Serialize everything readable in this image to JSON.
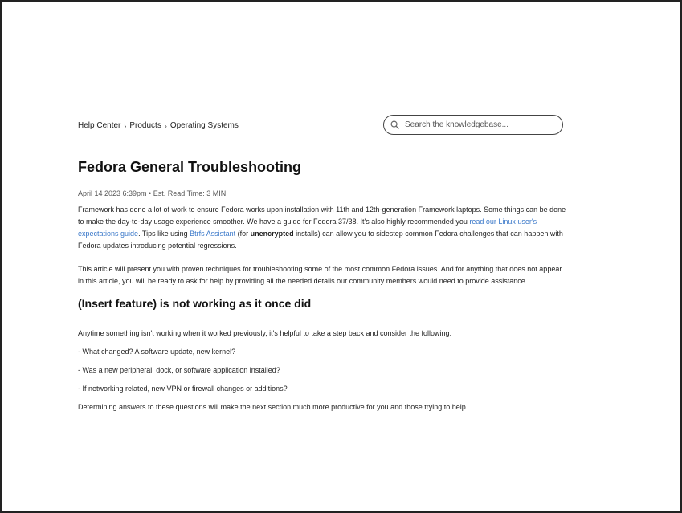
{
  "breadcrumb": {
    "items": [
      "Help Center",
      "Products",
      "Operating Systems"
    ],
    "separator": "›"
  },
  "search": {
    "placeholder": "Search the knowledgebase...",
    "value": ""
  },
  "article": {
    "title": "Fedora General Troubleshooting",
    "meta": "April 14 2023 6:39pm • Est. Read Time: 3 MIN",
    "intro": {
      "part1": "Framework has done a lot of work to ensure Fedora works upon installation with 11th and 12th-generation Framework laptops. Some things can be done to make the day-to-day usage experience smoother. We have a guide for Fedora 37/38. It's also highly recommended you ",
      "link1": "read our Linux user's expectations guide",
      "part2": ". Tips like using ",
      "link2": "Btrfs Assistant",
      "part3": " (for ",
      "bold": "unencrypted",
      "part4": " installs) can allow you to sidestep common Fedora challenges that can happen with  Fedora updates introducing potential regressions."
    },
    "paragraph2": "This article will present you with proven techniques for troubleshooting some of the most common Fedora issues. And for anything that does not appear in this article, you will be ready to ask for help by providing all the needed details our community members would need to provide assistance.",
    "section_heading": "(Insert feature) is not working as it once did",
    "list_intro": "Anytime something isn't working when it worked previously, it's helpful to take a step back and consider the following:",
    "items": [
      "- What changed? A software update, new kernel?",
      "- Was a new peripheral, dock, or software application installed?",
      "- If networking related, new VPN or firewall changes or additions?"
    ],
    "closing": "Determining answers to these questions will make the next section much more productive for you and those trying to help"
  },
  "colors": {
    "link": "#3a78c9",
    "text": "#222222"
  }
}
